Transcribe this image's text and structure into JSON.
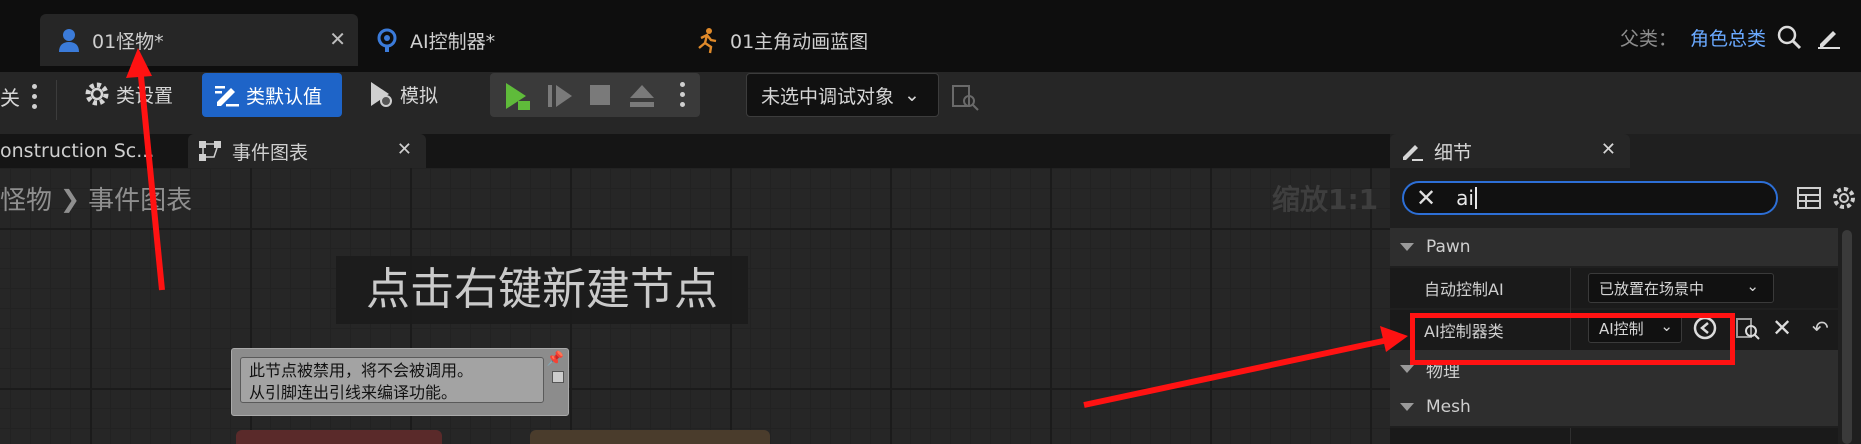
{
  "tabs": [
    {
      "label": "01怪物*"
    },
    {
      "label": "AI控制器*"
    },
    {
      "label": "01主角动画蓝图"
    }
  ],
  "parent_class": {
    "label": "父类：",
    "value": "角色总类"
  },
  "toolbar": {
    "edge_text": "关",
    "class_settings": "类设置",
    "class_defaults": "类默认值",
    "simulate": "模拟",
    "debug_object": "未选中调试对象"
  },
  "graph": {
    "subtabs": [
      {
        "label": "onstruction Sc..."
      },
      {
        "label": "事件图表"
      }
    ],
    "breadcrumb": {
      "parent": "怪物",
      "current": "事件图表"
    },
    "zoom": "缩放1:1",
    "hint": "点击右键新建节点",
    "comment_lines": [
      "此节点被禁用，将不会被调用。",
      "从引脚连出引线来编译功能。"
    ]
  },
  "details": {
    "title": "细节",
    "search_value": "ai",
    "categories": {
      "pawn": "Pawn",
      "physics": "物理",
      "mesh": "Mesh"
    },
    "props": {
      "auto_possess_ai": {
        "name": "自动控制AI",
        "value": "已放置在场景中"
      },
      "ai_controller_class": {
        "name": "AI控制器类",
        "value": "AI控制"
      }
    }
  },
  "colors": {
    "accent": "#1e64c8",
    "annotation": "#ff1212",
    "link": "#6aa9ff"
  }
}
